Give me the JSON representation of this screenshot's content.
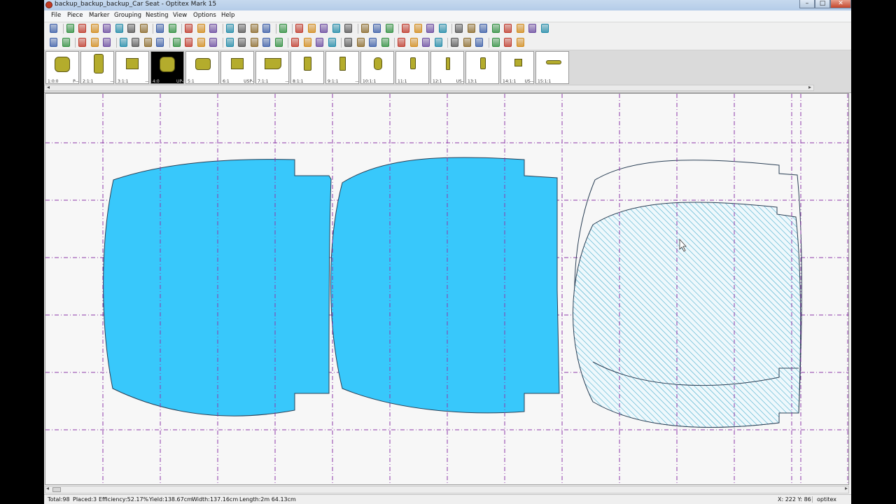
{
  "window": {
    "title": "backup_backup_backup_Car Seat - Optitex Mark 15",
    "minimize": "–",
    "maximize": "□",
    "close": "✕"
  },
  "menu": [
    "File",
    "Piece",
    "Marker",
    "Grouping",
    "Nesting",
    "View",
    "Options",
    "Help"
  ],
  "toolbar1_icons": [
    "pointer-icon",
    "new-file-icon",
    "open-file-icon",
    "save-icon",
    "open-recent-icon",
    "print-icon",
    "print-preview-icon",
    "excel-export-icon",
    "undo-icon",
    "redo-icon",
    "export-icon",
    "binoculars-icon",
    "copy-icon",
    "paste-icon",
    "duplicate-icon",
    "info-icon",
    "notes-icon",
    "recycle-icon",
    "ruler-icon",
    "measure-icon",
    "text-icon",
    "pick-icon",
    "zoom-icon",
    "zoom-window-icon",
    "zoom-fit-icon",
    "zoom-out-icon",
    "grid-icon",
    "split-icon",
    "delete-piece-icon",
    "group-icon",
    "align-icon",
    "stack-icon",
    "nest-icon",
    "nest-all-icon",
    "nest-pattern-icon",
    "color-icon",
    "fill-icon",
    "settings-icon"
  ],
  "toolbar2_icons": [
    "arrow-icon",
    "play-icon",
    "step-icon",
    "pause-icon",
    "stop-icon",
    "frame-icon",
    "select-all-icon",
    "clip-icon",
    "wand-icon",
    "find-icon",
    "next-icon",
    "layout-icon",
    "flip-icon",
    "rotate-icon",
    "move-left-icon",
    "move-right-icon",
    "move-down-icon",
    "move-up-icon",
    "triangle-icon",
    "play-forward-icon",
    "spread-icon",
    "refresh-icon",
    "swap-icon",
    "mirror-icon",
    "snap-icon",
    "tile-icon",
    "cut-icon",
    "x-delete-icon",
    "lock-icon",
    "edit-icon",
    "reload-icon",
    "check-icon",
    "bundle-icon",
    "measure2-icon",
    "layer-icon",
    "hatch-icon"
  ],
  "thumbnails": [
    {
      "left_label": "1:0:0",
      "right_label": "P--",
      "selected": false,
      "shape": "rounded"
    },
    {
      "left_label": "2:1:1",
      "right_label": "--",
      "selected": false,
      "shape": "tall-notch"
    },
    {
      "left_label": "3:1:1",
      "right_label": "--",
      "selected": false,
      "shape": "square"
    },
    {
      "left_label": "4:0",
      "right_label": "UP-",
      "selected": true,
      "shape": "rounded"
    },
    {
      "left_label": "5:1",
      "right_label": "",
      "selected": false,
      "shape": "wide-round"
    },
    {
      "left_label": "6:1",
      "right_label": "USP-",
      "selected": false,
      "shape": "square"
    },
    {
      "left_label": "7:1:1",
      "right_label": "--",
      "selected": false,
      "shape": "bevel"
    },
    {
      "left_label": "8:1:1",
      "right_label": "",
      "selected": false,
      "shape": "narrow-notch"
    },
    {
      "left_label": "9:1:1",
      "right_label": "--",
      "selected": false,
      "shape": "narrow"
    },
    {
      "left_label": "10:1:1",
      "right_label": "",
      "selected": false,
      "shape": "small-round"
    },
    {
      "left_label": "11:1",
      "right_label": "",
      "selected": false,
      "shape": "narrow-sm"
    },
    {
      "left_label": "12:1",
      "right_label": "US-",
      "selected": false,
      "shape": "sliver"
    },
    {
      "left_label": "13:1",
      "right_label": "",
      "selected": false,
      "shape": "narrow-sm"
    },
    {
      "left_label": "14:1:1",
      "right_label": "US--",
      "selected": false,
      "shape": "tiny"
    },
    {
      "left_label": "15:1:1",
      "right_label": "",
      "selected": false,
      "shape": "strip"
    }
  ],
  "status": {
    "total": "Total:98",
    "placed": "Placed:3",
    "efficiency": "Efficiency:52.17%",
    "yield": "Yield:138.67cm",
    "width": "Width:137.16cm",
    "length": "Length:2m 64.13cm",
    "coords": "X: 222 Y: 86",
    "brand": "optitex"
  },
  "colors": {
    "placed_piece_fill": "#38c8fb",
    "thumbnail_piece_fill": "#b4ac2c",
    "grid_line": "#8c3aa8",
    "hatch": "#3aa6c8"
  }
}
